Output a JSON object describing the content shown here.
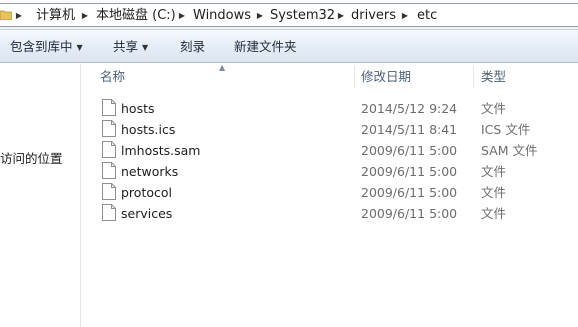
{
  "addressbar": {
    "breadcrumbs": [
      "计算机",
      "本地磁盘 (C:)",
      "Windows",
      "System32",
      "drivers",
      "etc"
    ]
  },
  "toolbar": {
    "include_label": "包含到库中",
    "share_label": "共享",
    "burn_label": "刻录",
    "new_folder_label": "新建文件夹"
  },
  "navpane": {
    "recent_places_label": "访问的位置"
  },
  "filelist": {
    "columns": [
      "名称",
      "修改日期",
      "类型"
    ],
    "rows": [
      {
        "name": "hosts",
        "modified": "2014/5/12 9:24",
        "type": "文件"
      },
      {
        "name": "hosts.ics",
        "modified": "2014/5/11 8:41",
        "type": "ICS 文件"
      },
      {
        "name": "lmhosts.sam",
        "modified": "2009/6/11 5:00",
        "type": "SAM 文件"
      },
      {
        "name": "networks",
        "modified": "2009/6/11 5:00",
        "type": "文件"
      },
      {
        "name": "protocol",
        "modified": "2009/6/11 5:00",
        "type": "文件"
      },
      {
        "name": "services",
        "modified": "2009/6/11 5:00",
        "type": "文件"
      }
    ]
  },
  "icons": {
    "folder": "folder-icon",
    "breadcrumb_separator": "chevron-right-icon",
    "dropdown": "chevron-down-icon",
    "file": "document-icon",
    "sort": "sort-ascending-icon"
  },
  "colors": {
    "header_text": "#4c607a",
    "secondary_text": "#6d6d6d",
    "toolbar_bg": "#dbe5f1"
  }
}
